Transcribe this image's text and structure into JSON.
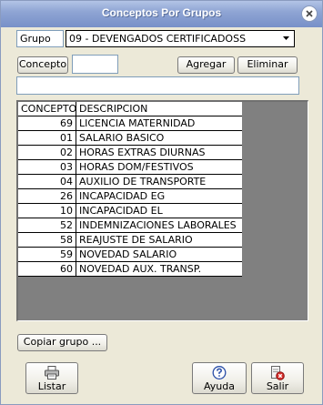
{
  "window": {
    "title": "Conceptos Por Grupos"
  },
  "group": {
    "label": "Grupo",
    "selected": "09 - DEVENGADOS CERTIFICADOSS"
  },
  "concept": {
    "label": "Concepto",
    "value": ""
  },
  "buttons": {
    "add": "Agregar",
    "remove": "Eliminar",
    "copy_group": "Copiar grupo ...",
    "list": "Listar",
    "help": "Ayuda",
    "exit": "Salir"
  },
  "table": {
    "columns": [
      "CONCEPTO",
      "DESCRIPCION"
    ],
    "rows": [
      {
        "code": "69",
        "desc": "LICENCIA MATERNIDAD"
      },
      {
        "code": "01",
        "desc": "SALARIO BASICO"
      },
      {
        "code": "02",
        "desc": "HORAS EXTRAS DIURNAS"
      },
      {
        "code": "03",
        "desc": "HORAS DOM/FESTIVOS"
      },
      {
        "code": "04",
        "desc": "AUXILIO DE TRANSPORTE"
      },
      {
        "code": "26",
        "desc": "INCAPACIDAD EG"
      },
      {
        "code": "10",
        "desc": "INCAPACIDAD EL"
      },
      {
        "code": "52",
        "desc": "INDEMNIZACIONES LABORALES"
      },
      {
        "code": "58",
        "desc": "REAJUSTE DE SALARIO"
      },
      {
        "code": "59",
        "desc": "NOVEDAD SALARIO"
      },
      {
        "code": "60",
        "desc": "NOVEDAD AUX. TRANSP."
      }
    ]
  },
  "icons": {
    "close": "close-icon",
    "dropdown": "chevron-down-icon",
    "list": "printer-icon",
    "help": "help-icon",
    "exit": "exit-icon"
  }
}
